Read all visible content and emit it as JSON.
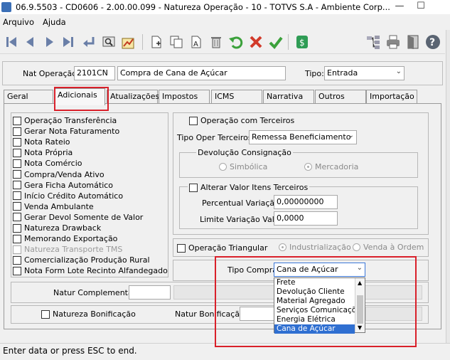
{
  "window": {
    "title": "06.9.5503 - CD0606 - 2.00.00.099 - Natureza Operação - 10 - TOTVS S.A - Ambiente Corp...",
    "minimize": "—",
    "maximize": "☐"
  },
  "menu": [
    "Arquivo",
    "Ajuda"
  ],
  "header": {
    "nat_label": "Nat Operação:",
    "nat_code": "2101CN",
    "nat_desc": "Compra de Cana de Açúcar",
    "tipo_label": "Tipo:",
    "tipo_value": "Entrada"
  },
  "tabs": [
    "Geral",
    "Adicionais",
    "Atualizações",
    "Impostos",
    "ICMS",
    "Narrativa",
    "Outros",
    "Importação"
  ],
  "left_checks": [
    {
      "label": "Operação Transferência",
      "enabled": true
    },
    {
      "label": "Gerar Nota Faturamento",
      "enabled": true
    },
    {
      "label": "Nota Rateio",
      "enabled": true
    },
    {
      "label": "Nota Própria",
      "enabled": true
    },
    {
      "label": "Nota Comércio",
      "enabled": true
    },
    {
      "label": "Compra/Venda Ativo",
      "enabled": true
    },
    {
      "label": "Gera Ficha Automático",
      "enabled": true
    },
    {
      "label": "Início Crédito Automático",
      "enabled": true
    },
    {
      "label": "Venda Ambulante",
      "enabled": true
    },
    {
      "label": "Gerar Devol Somente de Valor",
      "enabled": true
    },
    {
      "label": "Natureza Drawback",
      "enabled": true
    },
    {
      "label": "Memorando Exportação",
      "enabled": true
    },
    {
      "label": "Natureza Transporte TMS",
      "enabled": false
    },
    {
      "label": "Comercialização Produção Rural",
      "enabled": true
    },
    {
      "label": "Nota Form Lote Recinto Alfandegado",
      "enabled": true
    }
  ],
  "terceiros": {
    "check_label": "Operação com Terceiros",
    "tipo_label": "Tipo Oper Terceiros:",
    "tipo_value": "Remessa Beneficiamento",
    "devol_title": "Devolução Consignação",
    "radio_simb": "Simbólica",
    "radio_merc": "Mercadoria",
    "alterar_label": "Alterar Valor Itens Terceiros",
    "perc_label": "Percentual Variação:",
    "perc_value": "0,00000000",
    "limite_label": "Limite Variação Valor:",
    "limite_value": "0,0000"
  },
  "triangular": {
    "check_label": "Operação Triangular",
    "radio_ind": "Industrialização",
    "radio_venda": "Venda à Ordem"
  },
  "compra": {
    "label": "Tipo Compra:",
    "value": "Cana de Açúcar",
    "options": [
      "Frete",
      "Devolução Cliente",
      "Material Agregado",
      "Serviços Comunicações",
      "Energia Elétrica",
      "Cana de Açúcar"
    ],
    "selected_index": 5
  },
  "bottom": {
    "natur_comp_label": "Natur Complementar:",
    "natur_bonif_check": "Natureza Bonificação",
    "natur_bonif_label": "Natur Bonificação:"
  },
  "status": "Enter data or press ESC to end."
}
